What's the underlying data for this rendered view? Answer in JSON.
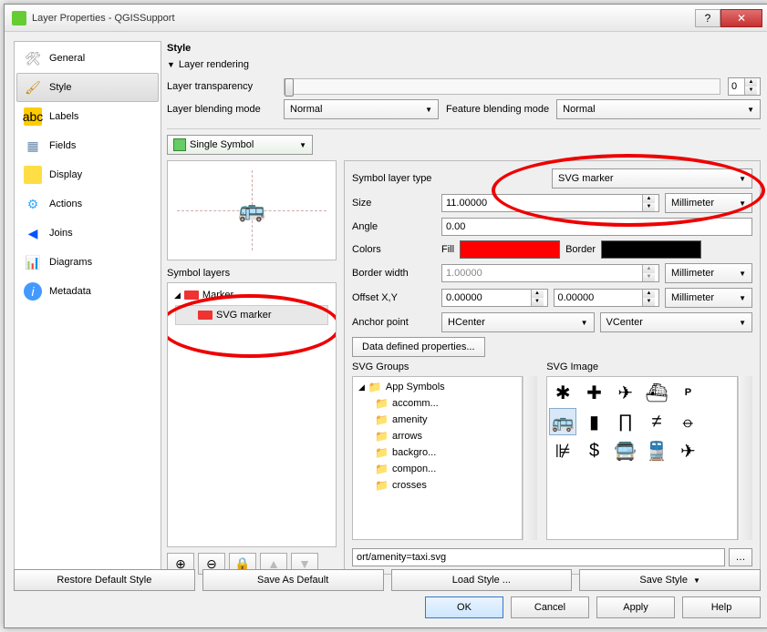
{
  "window": {
    "title": "Layer Properties - QGISSupport"
  },
  "nav": {
    "items": [
      "General",
      "Style",
      "Labels",
      "Fields",
      "Display",
      "Actions",
      "Joins",
      "Diagrams",
      "Metadata"
    ],
    "selected": 1
  },
  "style": {
    "section": "Style",
    "rendering_header": "Layer rendering",
    "transparency_label": "Layer transparency",
    "transparency_value": "0",
    "layer_blend_label": "Layer blending mode",
    "layer_blend_value": "Normal",
    "feature_blend_label": "Feature blending mode",
    "feature_blend_value": "Normal",
    "renderer": "Single Symbol",
    "symbol_layers_label": "Symbol layers",
    "tree_root": "Marker",
    "tree_child": "SVG marker"
  },
  "props": {
    "symbol_layer_type_label": "Symbol layer type",
    "symbol_layer_type_value": "SVG marker",
    "size_label": "Size",
    "size_value": "11.00000",
    "size_unit": "Millimeter",
    "angle_label": "Angle",
    "angle_value": "0.00",
    "colors_label": "Colors",
    "fill_label": "Fill",
    "border_label": "Border",
    "fill_color": "#ff0000",
    "border_color": "#000000",
    "border_width_label": "Border width",
    "border_width_value": "1.00000",
    "border_width_unit": "Millimeter",
    "offset_label": "Offset X,Y",
    "offset_x": "0.00000",
    "offset_y": "0.00000",
    "offset_unit": "Millimeter",
    "anchor_label": "Anchor point",
    "anchor_h": "HCenter",
    "anchor_v": "VCenter",
    "data_defined_label": "Data defined properties...",
    "svg_groups_label": "SVG Groups",
    "svg_image_label": "SVG Image",
    "groups": [
      "App Symbols",
      "accomm...",
      "amenity",
      "arrows",
      "backgro...",
      "compon...",
      "crosses"
    ],
    "svg_path": "ort/amenity=taxi.svg"
  },
  "footer": {
    "restore": "Restore Default Style",
    "saveas": "Save As Default",
    "load": "Load Style ...",
    "save": "Save Style",
    "ok": "OK",
    "cancel": "Cancel",
    "apply": "Apply",
    "help": "Help"
  },
  "chart_data": null
}
